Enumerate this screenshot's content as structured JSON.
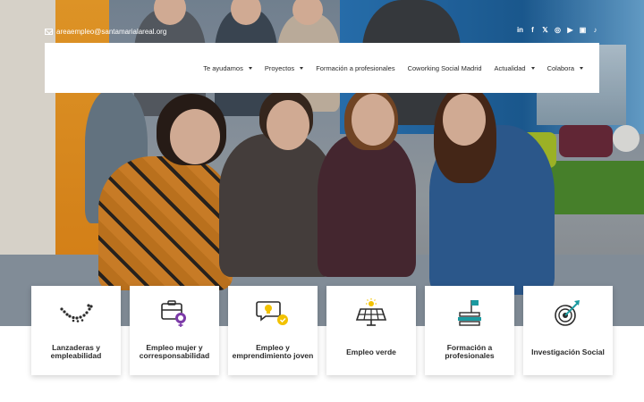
{
  "header": {
    "email": "areaempleo@santamarialareal.org",
    "social_icons": [
      "linkedin-icon",
      "facebook-icon",
      "x-icon",
      "instagram-icon",
      "youtube-icon",
      "twitch-icon",
      "tiktok-icon"
    ]
  },
  "nav": {
    "items": [
      {
        "label": "Te ayudamos",
        "dropdown": true
      },
      {
        "label": "Proyectos",
        "dropdown": true
      },
      {
        "label": "Formación a profesionales",
        "dropdown": false
      },
      {
        "label": "Coworking Social Madrid",
        "dropdown": false
      },
      {
        "label": "Actualidad",
        "dropdown": true
      },
      {
        "label": "Colabora",
        "dropdown": true
      }
    ]
  },
  "cards": [
    {
      "label": "Lanzaderas y empleabilidad",
      "icon": "dotted-arc-icon"
    },
    {
      "label": "Empleo mujer y corresponsabilidad",
      "icon": "briefcase-female-icon"
    },
    {
      "label": "Empleo y emprendimiento joven",
      "icon": "chat-idea-icon"
    },
    {
      "label": "Empleo verde",
      "icon": "solar-panel-icon"
    },
    {
      "label": "Formación a profesionales",
      "icon": "books-flag-icon"
    },
    {
      "label": "Investigación Social",
      "icon": "target-icon"
    }
  ],
  "colors": {
    "accent_yellow": "#f2c200",
    "accent_purple": "#7c3aa8",
    "accent_teal": "#1b9aa0",
    "text_dark": "#2b2b2b"
  }
}
